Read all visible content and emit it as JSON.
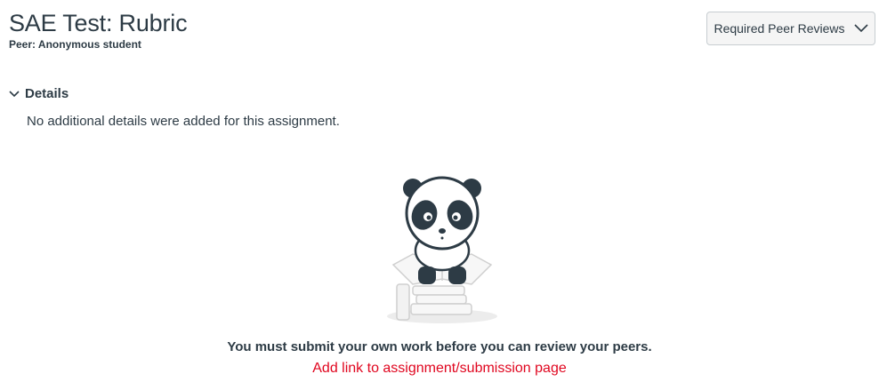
{
  "header": {
    "title": "SAE Test: Rubric",
    "peer_label": "Peer: Anonymous student",
    "peer_reviews_button": "Required Peer Reviews"
  },
  "details": {
    "toggle_label": "Details",
    "text": "No additional details were added for this assignment."
  },
  "empty_state": {
    "illustration": "panda-reading-illustration",
    "message": "You must submit your own work before you can review your peers.",
    "link_text": "Add link to assignment/submission page"
  },
  "colors": {
    "text": "#2d3b45",
    "link": "#e0061f",
    "button_bg": "#f5f5f5",
    "button_border": "#c7cdd1"
  },
  "icons": {
    "peer_reviews_button": "chevron-down-icon",
    "details_toggle": "chevron-down-icon"
  }
}
